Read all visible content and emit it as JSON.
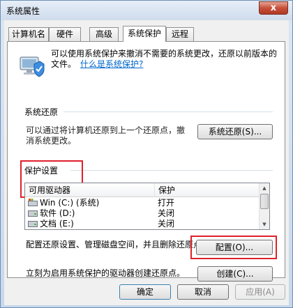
{
  "window": {
    "title": "系统属性",
    "close_glyph": "x"
  },
  "tabs": [
    {
      "label": "计算机名"
    },
    {
      "label": "硬件"
    },
    {
      "label": "高级"
    },
    {
      "label": "系统保护"
    },
    {
      "label": "远程"
    }
  ],
  "active_tab": "系统保护",
  "intro": {
    "text": "可以使用系统保护来撤消不需要的系统更改，还原以前版本的文件。",
    "link": "什么是系统保护?"
  },
  "restore": {
    "group_title": "系统还原",
    "description": "可以通过将计算机还原到上一个还原点，撤消系统更改。",
    "button": "系统还原(S)..."
  },
  "protection": {
    "group_title": "保护设置",
    "columns": [
      "可用驱动器",
      "保护"
    ],
    "drives": [
      {
        "name": "Win (C:) (系统)",
        "protection": "打开",
        "icon": "windows-drive-icon"
      },
      {
        "name": "软件 (D:)",
        "protection": "关闭",
        "icon": "drive-icon"
      },
      {
        "name": "文档 (E:)",
        "protection": "关闭",
        "icon": "drive-icon"
      }
    ],
    "configure_description": "配置还原设置、管理磁盘空间，并且删除还原点。",
    "configure_button": "配置(O)...",
    "create_description": "立刻为启用系统保护的驱动器创建还原点。",
    "create_button": "创建(C)..."
  },
  "footer": {
    "ok": "确定",
    "cancel": "取消",
    "apply": "应用(A)"
  },
  "colors": {
    "highlight_box": "#e0202a",
    "link": "#0066cc"
  }
}
